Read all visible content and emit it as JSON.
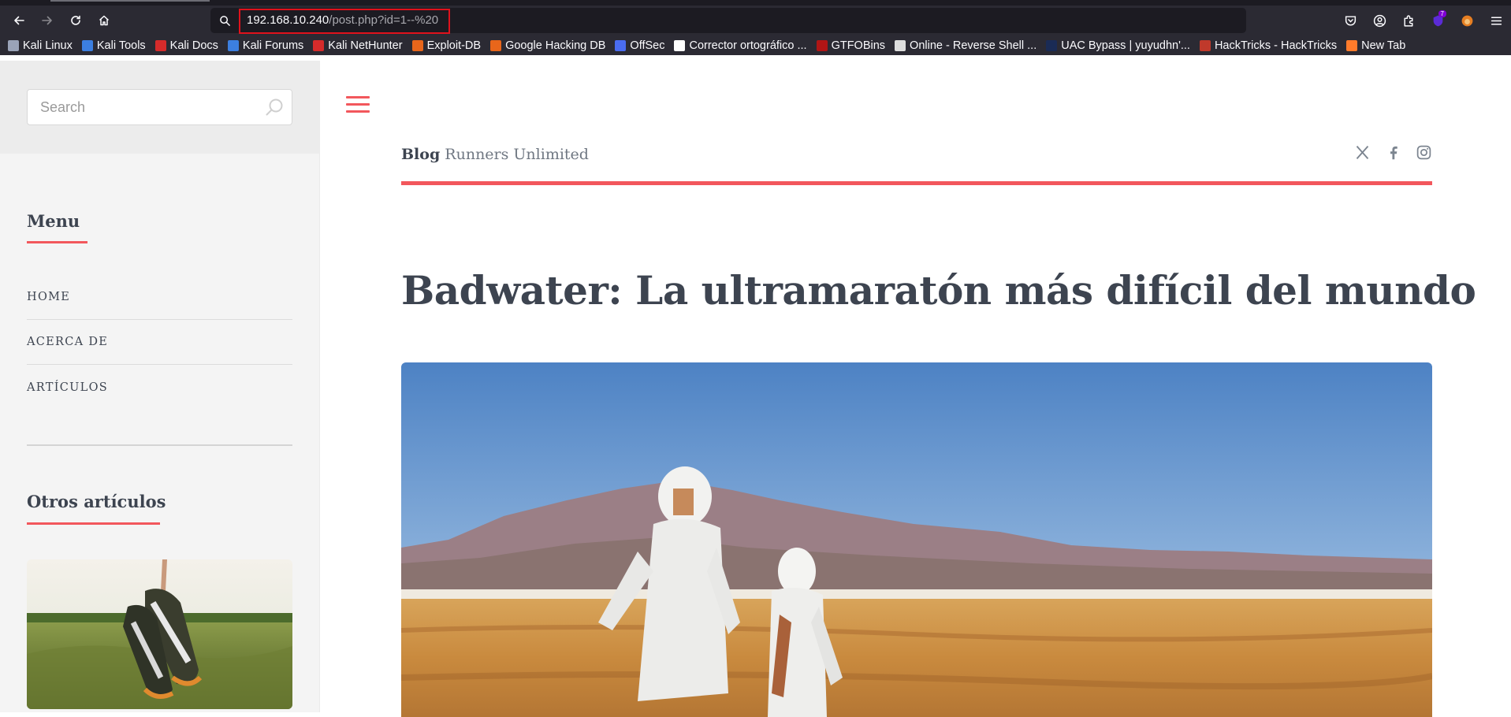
{
  "browser": {
    "url_host": "192.168.10.240",
    "url_path": "/post.php?id=1--%20",
    "extensions_badge": "7",
    "bookmarks": [
      {
        "label": "Kali Linux",
        "icon": "kali-dragon-icon",
        "color": "#9aa3b8"
      },
      {
        "label": "Kali Tools",
        "icon": "kali-tools-icon",
        "color": "#3c7fe0"
      },
      {
        "label": "Kali Docs",
        "icon": "kali-docs-icon",
        "color": "#d62b2b"
      },
      {
        "label": "Kali Forums",
        "icon": "kali-forums-icon",
        "color": "#3c7fe0"
      },
      {
        "label": "Kali NetHunter",
        "icon": "nethunter-icon",
        "color": "#d62b2b"
      },
      {
        "label": "Exploit-DB",
        "icon": "exploit-db-icon",
        "color": "#e8661b"
      },
      {
        "label": "Google Hacking DB",
        "icon": "ghdb-icon",
        "color": "#e8661b"
      },
      {
        "label": "OffSec",
        "icon": "offsec-icon",
        "color": "#4a6cf0"
      },
      {
        "label": "Corrector ortográfico ...",
        "icon": "corrector-icon",
        "color": "#ffffff"
      },
      {
        "label": "GTFOBins",
        "icon": "gtfobins-icon",
        "color": "#b01515"
      },
      {
        "label": "Online - Reverse Shell ...",
        "icon": "skull-icon",
        "color": "#dddddd"
      },
      {
        "label": "UAC Bypass | yuyudhn'...",
        "icon": "uac-bypass-icon",
        "color": "#1a2b55"
      },
      {
        "label": "HackTricks - HackTricks",
        "icon": "hacktricks-icon",
        "color": "#c0392b"
      },
      {
        "label": "New Tab",
        "icon": "firefox-icon",
        "color": "#ff7b2b"
      }
    ]
  },
  "sidebar": {
    "search_placeholder": "Search",
    "menu_heading": "Menu",
    "menu_items": [
      "HOME",
      "ACERCA DE",
      "ARTÍCULOS"
    ],
    "other_heading": "Otros artículos"
  },
  "header": {
    "logo_bold": "Blog",
    "logo_rest": " Runners Unlimited",
    "social": [
      "x-twitter-icon",
      "facebook-icon",
      "instagram-icon"
    ]
  },
  "post": {
    "title": "Badwater: La ultramaratón más difícil del mundo"
  },
  "colors": {
    "accent": "#f2575c",
    "text_dark": "#3d4450",
    "chrome_bg": "#2b2a33",
    "url_highlight": "#e0121c"
  }
}
